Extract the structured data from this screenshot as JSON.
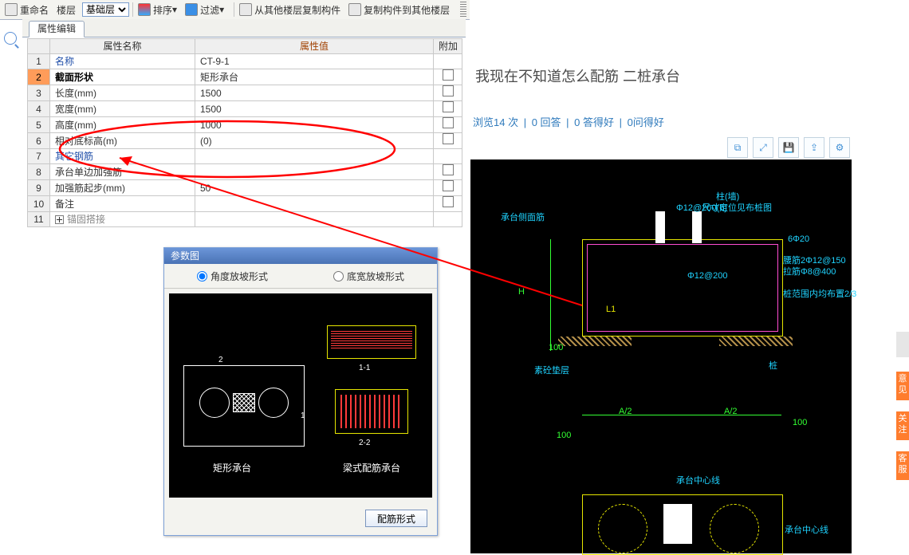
{
  "toolbar": {
    "rename": "重命名",
    "floor": "楼层",
    "floorSel": "基础层",
    "sort": "排序",
    "filter": "过滤",
    "copyFrom": "从其他楼层复制构件",
    "copyTo": "复制构件到其他楼层"
  },
  "tab": {
    "label": "属性编辑"
  },
  "table": {
    "headers": {
      "name": "属性名称",
      "value": "属性值",
      "extra": "附加"
    },
    "rows": [
      {
        "n": "1",
        "name": "名称",
        "val": "CT-9-1",
        "blue": true
      },
      {
        "n": "2",
        "name": "截面形状",
        "val": "矩形承台",
        "sel": true,
        "bold": true
      },
      {
        "n": "3",
        "name": "长度(mm)",
        "val": "1500"
      },
      {
        "n": "4",
        "name": "宽度(mm)",
        "val": "1500"
      },
      {
        "n": "5",
        "name": "高度(mm)",
        "val": "1000"
      },
      {
        "n": "6",
        "name": "相对底标高(m)",
        "val": "(0)"
      },
      {
        "n": "7",
        "name": "其它钢筋",
        "val": "",
        "blue": true
      },
      {
        "n": "8",
        "name": "承台单边加强筋",
        "val": ""
      },
      {
        "n": "9",
        "name": "加强筋起步(mm)",
        "val": "50"
      },
      {
        "n": "10",
        "name": "备注",
        "val": ""
      },
      {
        "n": "11",
        "name": "锚固搭接",
        "val": "",
        "expand": true
      }
    ]
  },
  "paramPanel": {
    "title": "参数图",
    "opt1": "角度放坡形式",
    "opt2": "底宽放坡形式",
    "button": "配筋形式",
    "cap1": "矩形承台",
    "cap2": "梁式配筋承台",
    "secA": "1-1",
    "secB": "2-2"
  },
  "right": {
    "title": "我现在不知道怎么配筋 二桩承台",
    "stats": {
      "views": "浏览14 次",
      "answers": "0 回答",
      "good": "0 答得好",
      "askGood": "0问得好"
    },
    "cadIcons": [
      "copy",
      "expand",
      "save",
      "share",
      "settings"
    ],
    "cadLabels": {
      "phi1": "Φ12@200(6)",
      "phi2": "Φ12@200",
      "pile": "柱(墙)",
      "pileNote": "尺寸定位见布桩图",
      "topbar": "6Φ20",
      "rs1": "腰筋2Φ12@150",
      "rs2": "拉筋Φ8@400",
      "rs3": "桩范围内均布置2/3",
      "cushion": "素砼垫层",
      "pileL": "桩",
      "a2a": "A/2",
      "a2b": "A/2",
      "h100a": "100",
      "h100b": "100",
      "sideLabel": "承台侧面筋",
      "H": "H",
      "L1": "L1",
      "centerline": "承台中心线"
    }
  },
  "float": {
    "a": "意见",
    "b": "关注",
    "c": "客服"
  }
}
